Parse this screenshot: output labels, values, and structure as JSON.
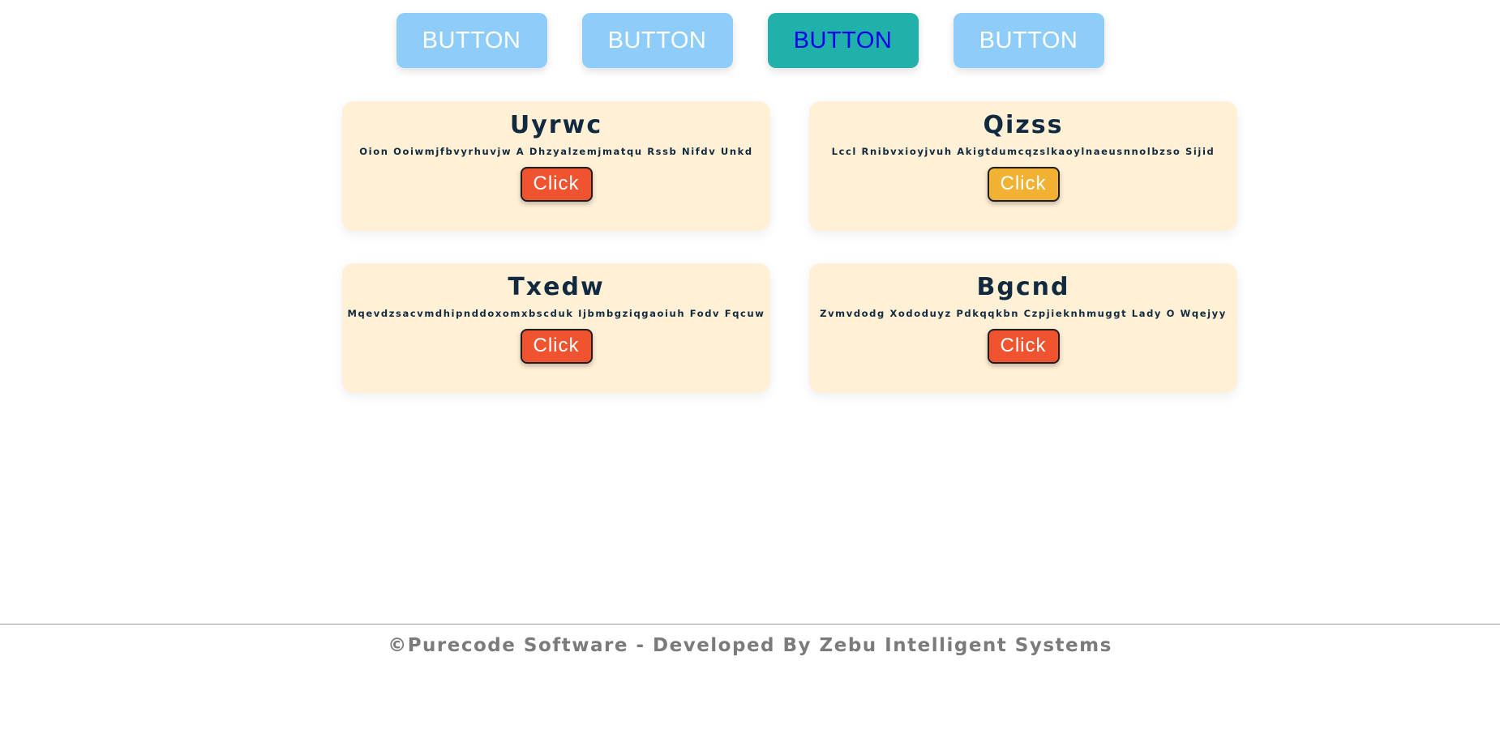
{
  "tabs": [
    {
      "label": "BUTTON",
      "active": false
    },
    {
      "label": "BUTTON",
      "active": false
    },
    {
      "label": "BUTTON",
      "active": true
    },
    {
      "label": "BUTTON",
      "active": false
    }
  ],
  "cards": [
    {
      "title": "Uyrwc",
      "text": "Oion Ooiwmjfbvyrhuvjw A Dhzyalzemjmatqu Rssb Nifdv Unkd",
      "button_label": "Click",
      "button_color": "#f0532f"
    },
    {
      "title": "Qizss",
      "text": "Lccl Rnibvxioyjvuh Akigtdumcqzslkaoylnaeusnnolbzso Sijid",
      "button_label": "Click",
      "button_color": "#f1b233"
    },
    {
      "title": "Txedw",
      "text": "Mqevdzsacvmdhipnddoxomxbscduk Ijbmbgziqgaoiuh Fodv Fqcuw",
      "button_label": "Click",
      "button_color": "#f0532f"
    },
    {
      "title": "Bgcnd",
      "text": "Zvmvdodg Xododuyz Pdkqqkbn Czpjieknhmuggt Lady O Wqejyy",
      "button_label": "Click",
      "button_color": "#f0532f"
    }
  ],
  "footer": {
    "text": "©Purecode Software - Developed By Zebu Intelligent Systems"
  },
  "colors": {
    "tab_default": "#8ecdf9",
    "tab_active": "#20b2aa",
    "tab_active_text": "#0000ee",
    "card_bg": "#fff0d6",
    "title_color": "#112a3f",
    "footer_color": "#7b7b7b"
  }
}
